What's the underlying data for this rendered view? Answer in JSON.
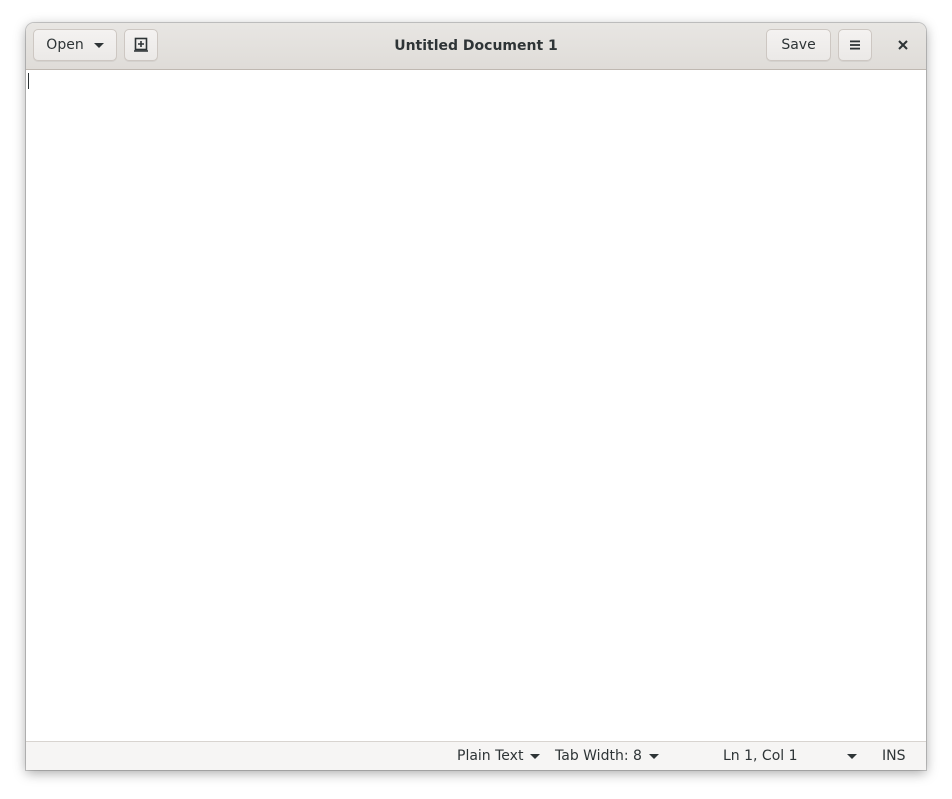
{
  "header": {
    "title": "Untitled Document 1",
    "open_label": "Open",
    "save_label": "Save",
    "icons": {
      "open_dropdown": "chevron-down-icon",
      "new_document": "new-document-icon",
      "menu": "hamburger-menu-icon",
      "close": "close-icon"
    }
  },
  "editor": {
    "content": ""
  },
  "statusbar": {
    "language": "Plain Text",
    "tab_width": "Tab Width: 8",
    "cursor_position": "Ln 1, Col 1",
    "insert_mode": "INS"
  }
}
